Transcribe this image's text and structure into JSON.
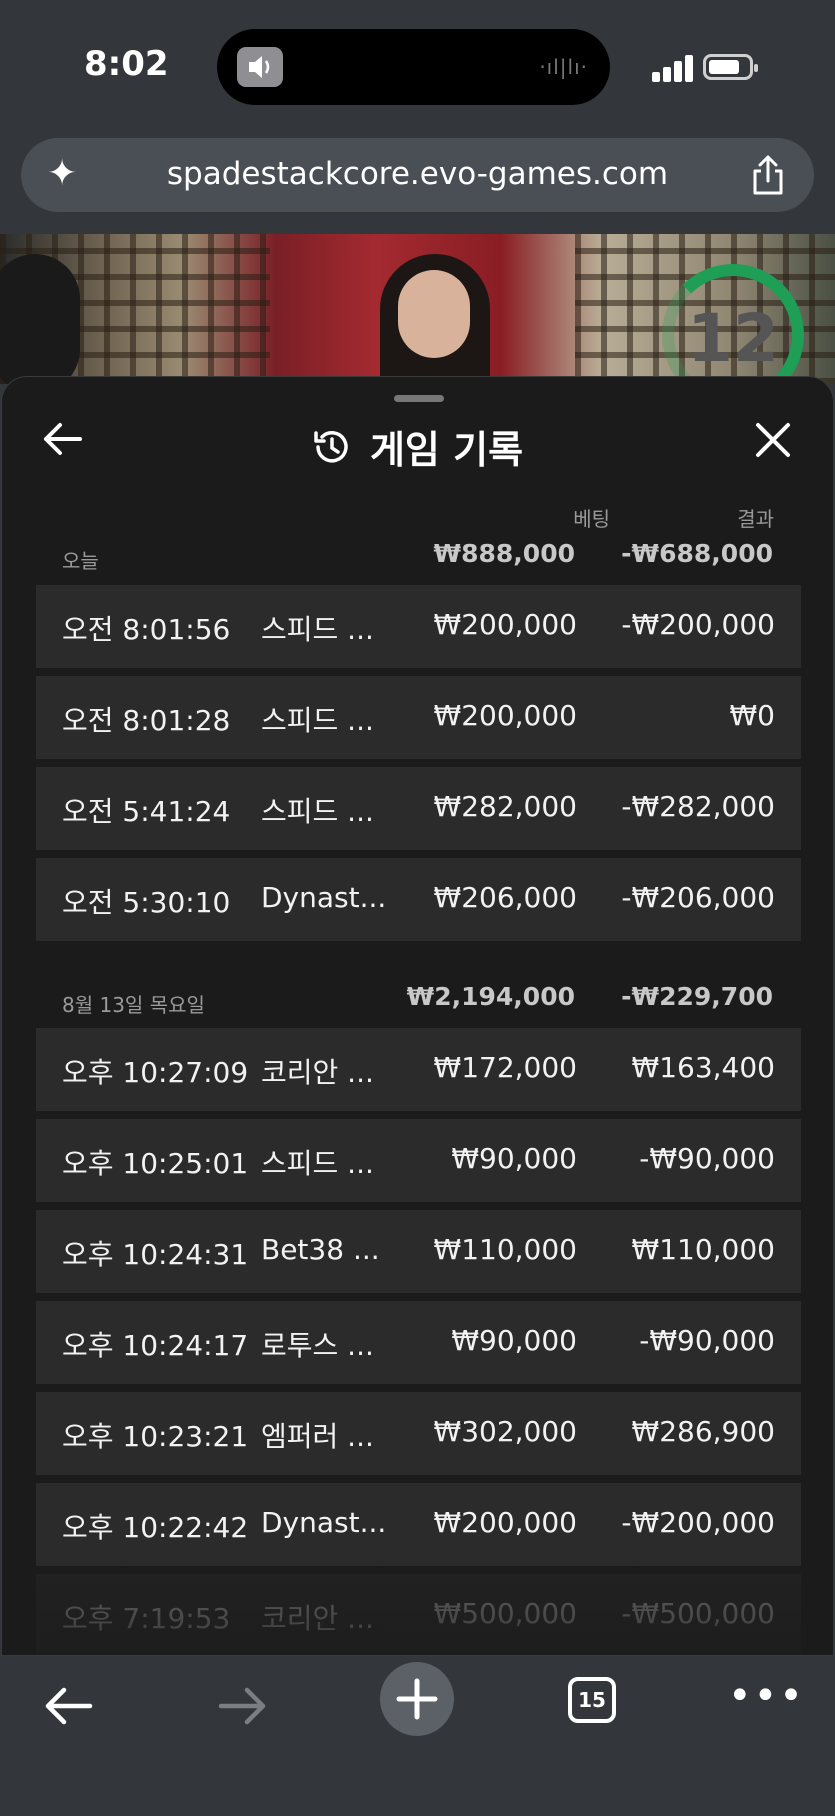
{
  "status": {
    "time": "8:02"
  },
  "browser": {
    "url": "spadestackcore.evo-games.com",
    "tab_count": "15"
  },
  "video": {
    "timer": "12"
  },
  "panel": {
    "title": "게임 기록",
    "col_bet": "베팅",
    "col_result": "결과",
    "sections": [
      {
        "label": "오늘",
        "bet_total": "₩888,000",
        "result_total": "-₩688,000",
        "rows": [
          {
            "time": "오전 8:01:56",
            "game": "스피드 ...",
            "bet": "₩200,000",
            "result": "-₩200,000"
          },
          {
            "time": "오전 8:01:28",
            "game": "스피드 ...",
            "bet": "₩200,000",
            "result": "₩0"
          },
          {
            "time": "오전 5:41:24",
            "game": "스피드 ...",
            "bet": "₩282,000",
            "result": "-₩282,000"
          },
          {
            "time": "오전 5:30:10",
            "game": "Dynast...",
            "bet": "₩206,000",
            "result": "-₩206,000"
          }
        ]
      },
      {
        "label": "8월 13일 목요일",
        "bet_total": "₩2,194,000",
        "result_total": "-₩229,700",
        "rows": [
          {
            "time": "오후 10:27:09",
            "game": "코리안 ...",
            "bet": "₩172,000",
            "result": "₩163,400"
          },
          {
            "time": "오후 10:25:01",
            "game": "스피드 ...",
            "bet": "₩90,000",
            "result": "-₩90,000"
          },
          {
            "time": "오후 10:24:31",
            "game": "Bet38 ...",
            "bet": "₩110,000",
            "result": "₩110,000"
          },
          {
            "time": "오후 10:24:17",
            "game": "로투스 ...",
            "bet": "₩90,000",
            "result": "-₩90,000"
          },
          {
            "time": "오후 10:23:21",
            "game": "엠퍼러 ...",
            "bet": "₩302,000",
            "result": "₩286,900"
          },
          {
            "time": "오후 10:22:42",
            "game": "Dynast...",
            "bet": "₩200,000",
            "result": "-₩200,000"
          },
          {
            "time": "오후 7:19:53",
            "game": "코리안 ...",
            "bet": "₩500,000",
            "result": "-₩500,000"
          }
        ]
      }
    ]
  }
}
